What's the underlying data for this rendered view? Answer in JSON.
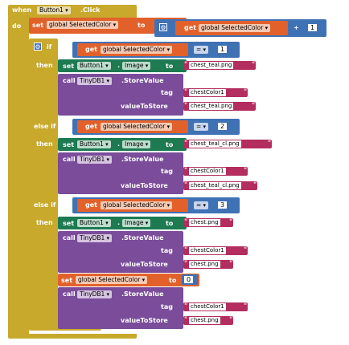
{
  "event": {
    "when": "when",
    "component": "Button1",
    "event_name": ".Click",
    "do": "do"
  },
  "kw": {
    "set": "set",
    "get": "get",
    "to": "to",
    "if": "if",
    "then": "then",
    "else_if": "else if",
    "call": "call",
    "tag": "tag",
    "value_to_store": "valueToStore",
    "plus": "+",
    "eq": "="
  },
  "vars": {
    "selected_color": "global SelectedColor"
  },
  "components": {
    "button": "Button1",
    "property": "Image",
    "db": "TinyDB1",
    "method": ".StoreValue"
  },
  "numbers": {
    "one": "1",
    "two": "2",
    "three": "3",
    "zero": "0"
  },
  "strings": {
    "chest_teal": "chest_teal.png",
    "chest_teal_cl": "chest_teal_cl.png",
    "chest": "chest.png",
    "chest_color_tag": "chestColor1"
  },
  "colors": {
    "event": "#c8a92c",
    "variable": "#e2612b",
    "math": "#3f71b5",
    "control": "#c8a92c",
    "component": "#1d7a51",
    "db_call": "#7a4c9a",
    "text": "#b32d5e"
  }
}
